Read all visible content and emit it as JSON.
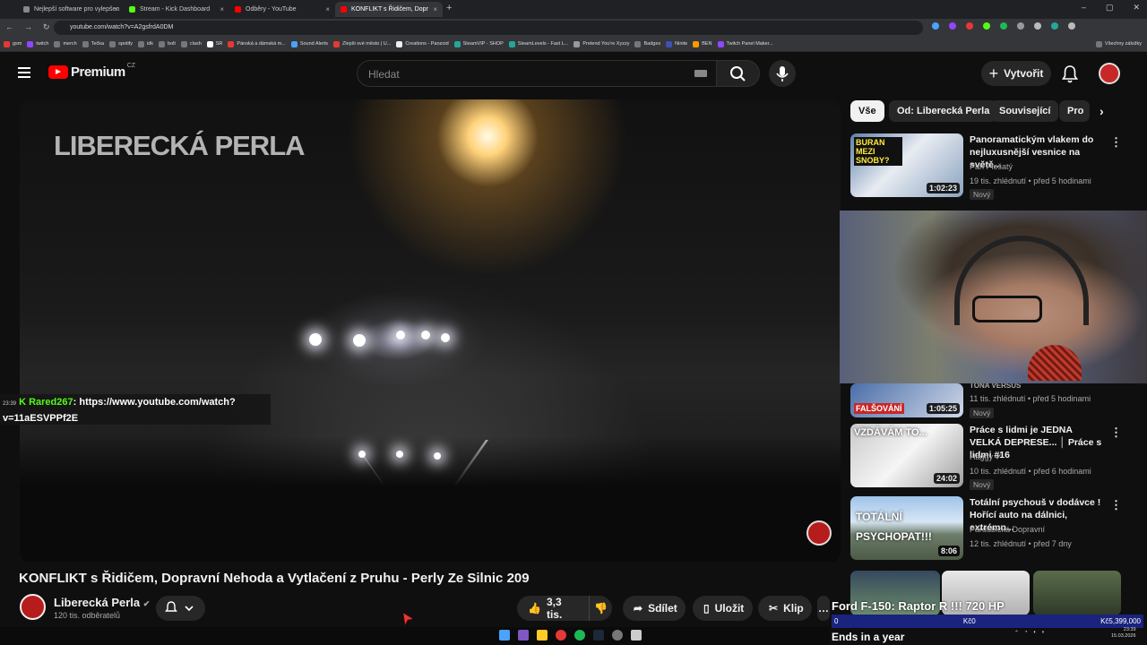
{
  "browser": {
    "tabs": [
      {
        "label": "Nejlepší software pro vylepšen",
        "color": "#888888"
      },
      {
        "label": "Stream - Kick Dashboard",
        "color": "#53fc18"
      },
      {
        "label": "Odběry - YouTube",
        "color": "#ff0000"
      },
      {
        "label": "KONFLIKT s Řidičem, Dopr",
        "color": "#ff0000",
        "active": true
      }
    ],
    "url": "youtube.com/watch?v=A2gsfrdA0DM",
    "bookmarks": [
      "gsm",
      "twitch",
      "merch",
      "Tečka",
      "spotify",
      "idk",
      "bolt",
      "clash",
      "SR",
      "Pánská a dámská m...",
      "Sound Alerts",
      "Zlepši své město | U...",
      "Creations - Panzoid",
      "SteamVIP - SHOP",
      "SteamLevels - Fast L...",
      "Pretend You're Xyzzy",
      "Badges",
      "Ninite",
      "BEN",
      "Twitch Panel Maker...",
      "Všechny záložky"
    ]
  },
  "header": {
    "logo_text": "Premium",
    "country": "CZ",
    "search_placeholder": "Hledat",
    "create_label": "Vytvořit"
  },
  "video": {
    "watermark": "LIBERECKÁ PERLA",
    "title": "KONFLIKT s Řidičem, Dopravní Nehoda a Vytlačení z Pruhu - Perly Ze Silnic 209",
    "channel": "Liberecká Perla",
    "subscribers": "120 tis. odběratelů",
    "likes": "3,3 tis.",
    "share_label": "Sdílet",
    "save_label": "Uložit",
    "clip_label": "Klip"
  },
  "chat": {
    "time": "23:39",
    "user": "Rared267",
    "message": ": https://www.youtube.com/watch?",
    "message2": "v=11aESVPPf2E"
  },
  "sidebar": {
    "chips": [
      "Vše",
      "Od: Liberecká Perla",
      "Související",
      "Pro"
    ],
    "cards": [
      {
        "title": "Panoramatickým vlakem do nejluxusnější vesnice na světě...",
        "channel": "Pan Plešatý",
        "meta": "19 tis. zhlédnutí • před 5 hodinami",
        "badge": "Nový",
        "duration": "1:02:23",
        "thumb_text": "BURAN MEZI SNOBY?"
      },
      {
        "title": "TONA VERSUS",
        "channel": "",
        "meta": "11 tis. zhlédnutí • před 5 hodinami",
        "badge": "Nový",
        "duration": "1:05:25",
        "thumb_text": "FALŠOVÁNÍ"
      },
      {
        "title": "Práce s lidmi je JEDNA VELKÁ DEPRESE... │ Práce s lidmi #16",
        "channel": "Haggy",
        "meta": "10 tis. zhlédnutí • před 6 hodinami",
        "badge": "Nový",
        "duration": "24:02",
        "thumb_text": "VZDÁVÁM TO..."
      },
      {
        "title": "Totální psychouš v dodávce ! Hořící auto na dálnici, extrémn...",
        "channel": "Pardubická Dopravní",
        "meta": "12 tis. zhlédnutí • před 7 dny",
        "badge": "",
        "duration": "8:06",
        "thumb_text": "TOTÁLNÍ PSYCHOPAT!!!"
      }
    ]
  },
  "stream_overlay": {
    "title": "Ford F-150: Raptor R !!! 720 HP",
    "goal_left": "0",
    "goal_mid": "Kč0",
    "goal_right": "Kč5,399,000",
    "ends": "Ends in a year"
  },
  "taskbar": {
    "time": "23:39",
    "date": "15.03.2026"
  }
}
